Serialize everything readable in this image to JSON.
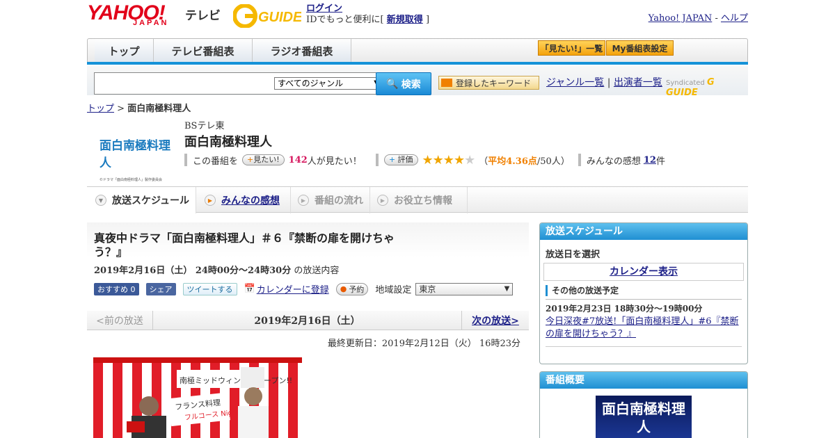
{
  "header": {
    "logo_text": "YAHOO!",
    "logo_sub": "JAPAN",
    "logo_tv": "テレビ",
    "gguide": "G-GUIDE",
    "login_link": "ログイン",
    "login_text": "IDでもっと便利に[",
    "signup_link": "新規取得",
    "login_close": "]",
    "yahoo_link": "Yahoo! JAPAN",
    "dash": "-",
    "help_link": "ヘルプ"
  },
  "nav": {
    "tabs": [
      "トップ",
      "テレビ番組表",
      "ラジオ番組表"
    ],
    "mitai_list": "「見たい!」一覧",
    "my_table": "My番組表設定"
  },
  "search": {
    "genre": "すべてのジャンル",
    "button": "検索",
    "keyword_btn": "登録したキーワード",
    "genre_list": "ジャンル一覧",
    "pipe": "|",
    "performer_list": "出演者一覧",
    "syndicated": "Syndicated"
  },
  "breadcrumb": {
    "top": "トップ",
    "sep": ">",
    "current": "面白南極料理人"
  },
  "program": {
    "thumb_title": "面白南極料理人",
    "thumb_credit": "©ドラマ「面白南極料理人」製作委員会",
    "station": "BSテレ東",
    "title": "面白南極料理人",
    "this_program": "この番組を",
    "mitai_btn": "見たい!",
    "mitai_count": "142",
    "mitai_suffix": "人が見たい！",
    "rate_btn": "評価",
    "rating_open": "（",
    "rating_avg": "平均4.36点",
    "rating_count": "/50人）",
    "rating": 4.36,
    "impressions_label": "みんなの感想",
    "impressions_count": "12",
    "impressions_suffix": "件"
  },
  "tabs": {
    "schedule": "放送スケジュール",
    "impressions": "みんなの感想",
    "flow": "番組の流れ",
    "info": "お役立ち情報"
  },
  "episode": {
    "title": "真夜中ドラマ「面白南極料理人」＃６『禁断の扉を開けちゃう？』",
    "datetime": "2019年2月16日（土） 24時00分～24時30分",
    "datetime_suffix": "の放送内容",
    "recommend": "おすすめ 0",
    "share": "シェア",
    "tweet": "ツイートする",
    "calendar": "カレンダーに登録",
    "reserve": "予約",
    "region_label": "地域設定",
    "region": "東京",
    "prev": "<前の放送",
    "current_date": "2019年2月16日（土）",
    "next": "次の放送>",
    "updated": "最終更新日：2019年2月12日（火） 16時23分",
    "photo_sign": "フランス料理 フルコース Night",
    "photo_banner": "南極ミッドウィンターオープン!!"
  },
  "sidebar": {
    "schedule_head": "放送スケジュール",
    "select_date": "放送日を選択",
    "calendar_link": "カレンダー表示",
    "other_head": "その他の放送予定",
    "other_datetime": "2019年2月23日 18時30分～19時00分",
    "other_link": "今日深夜#7放送!「面白南極料理人」#6『禁断の扉を開けちゃう？』",
    "overview_head": "番組概要",
    "overview_title": "面白南極料理人"
  }
}
